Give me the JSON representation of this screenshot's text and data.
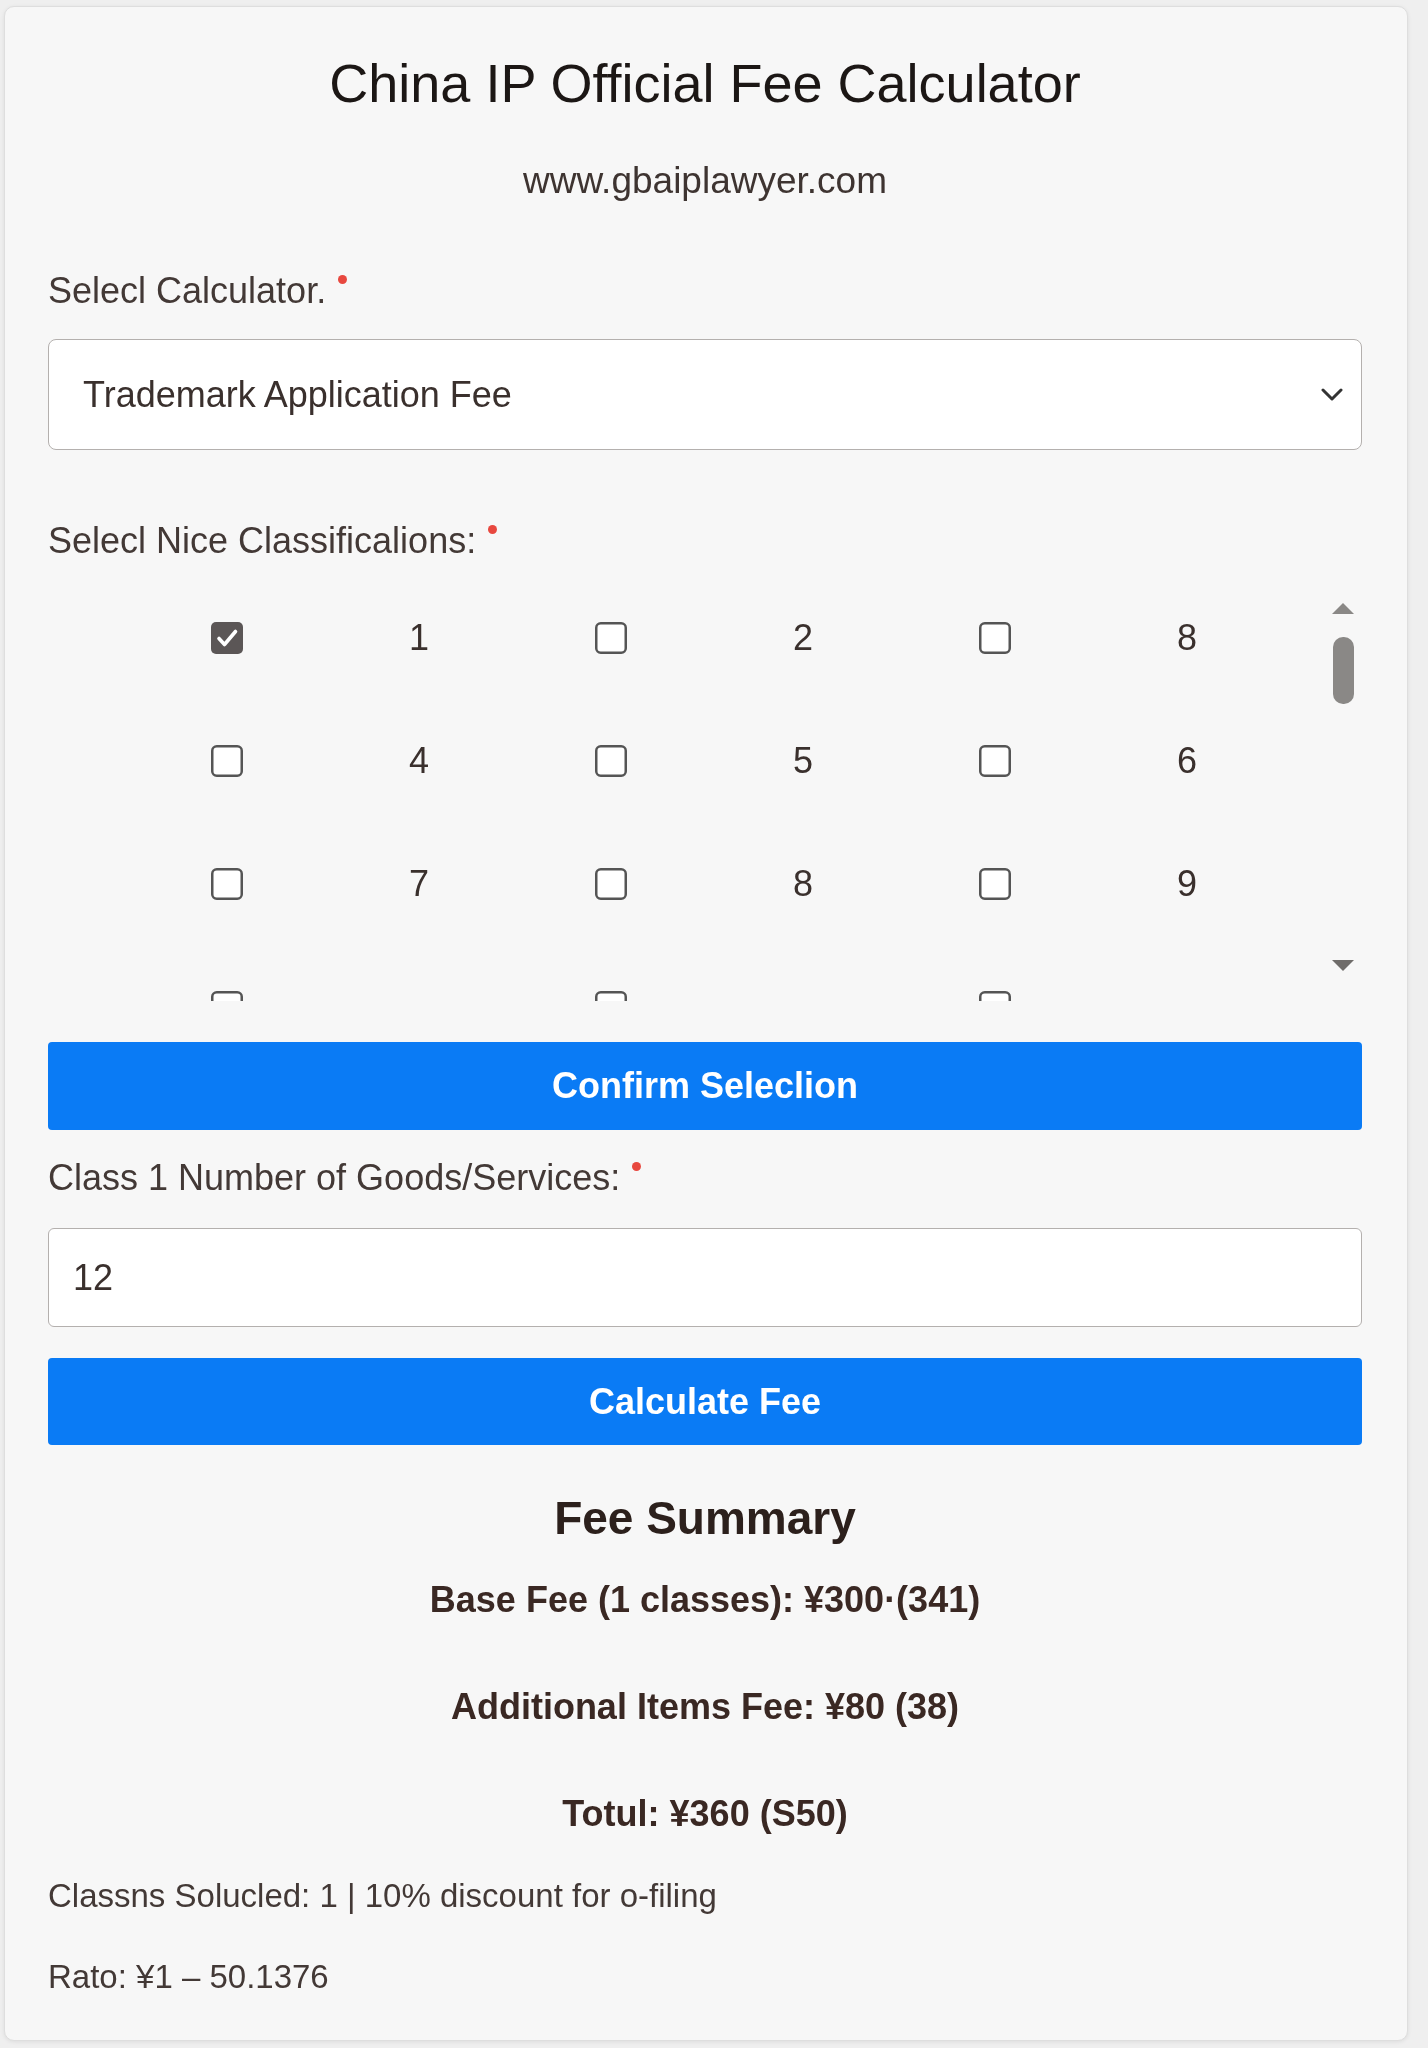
{
  "header": {
    "title": "China IP Official Fee Calculator",
    "website": "www.gbaiplawyer.com"
  },
  "calculator_select": {
    "label": "Selecl Calculator.",
    "required": true,
    "value": "Trademark Application Fee"
  },
  "classifications": {
    "label": "Selecl Nice Classificalions:",
    "required": true,
    "options": [
      {
        "label": "1",
        "checked": true
      },
      {
        "label": "2",
        "checked": false
      },
      {
        "label": "8",
        "checked": false
      },
      {
        "label": "4",
        "checked": false
      },
      {
        "label": "5",
        "checked": false
      },
      {
        "label": "6",
        "checked": false
      },
      {
        "label": "7",
        "checked": false
      },
      {
        "label": "8",
        "checked": false
      },
      {
        "label": "9",
        "checked": false
      },
      {
        "checked": false
      },
      {
        "checked": false
      },
      {
        "checked": false
      }
    ]
  },
  "confirm_button": "Confirm Seleclion",
  "goods_field": {
    "label": "Class 1 Number of Goods/Services:",
    "required": true,
    "value": "12"
  },
  "calculate_button": "Calculate Fee",
  "summary": {
    "title": "Fee Summary",
    "lines": [
      "Base Fee (1 classes): ¥300·(341)",
      "Additional Items Fee: ¥80 (38)",
      "Totul: ¥360 (S50)"
    ],
    "notes": [
      "Classns Solucled: 1 | 10% discount for o-filing",
      "Rato: ¥1 – 50.1376"
    ]
  }
}
